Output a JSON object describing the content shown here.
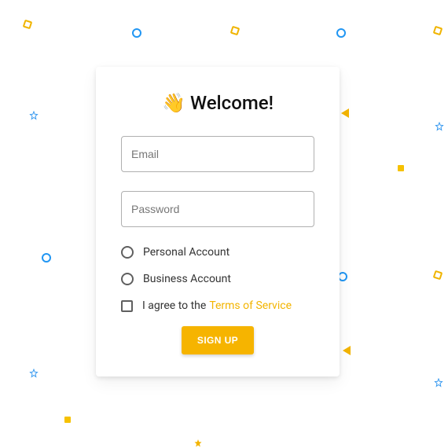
{
  "card": {
    "title": "Welcome!",
    "wave_emoji": "👋",
    "email_placeholder": "Email",
    "password_placeholder": "Password",
    "options": {
      "personal": "Personal Account",
      "business": "Business Account"
    },
    "agree_prefix": "I agree to the",
    "tos_label": "Terms of Service",
    "signup_label": "SIGN UP"
  },
  "colors": {
    "accent": "#f6b400",
    "confetti_blue": "#2196f3",
    "confetti_yellow": "#f3b400"
  }
}
